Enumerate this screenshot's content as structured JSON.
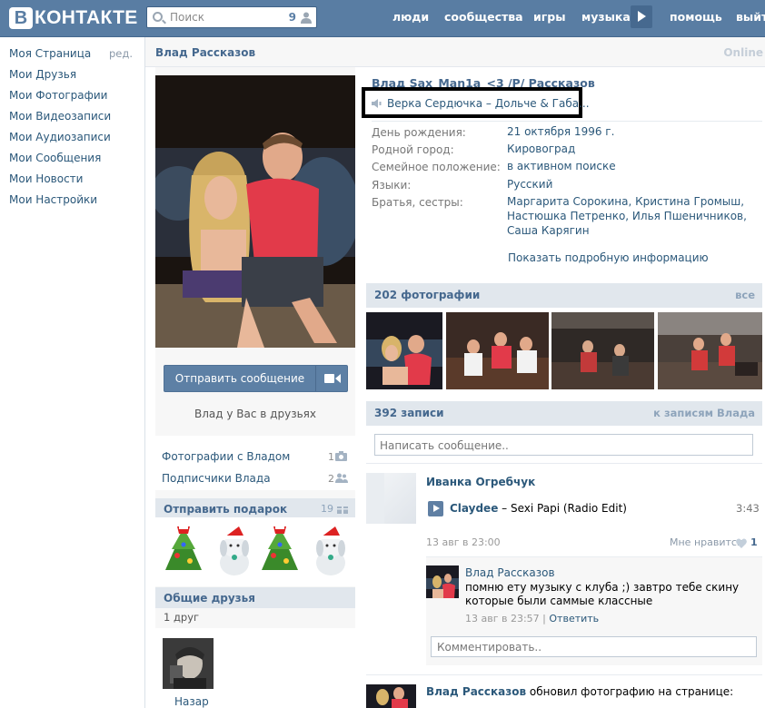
{
  "header": {
    "logo_letter": "В",
    "logo_text": "КОНТАКТЕ",
    "search_placeholder": "Поиск",
    "search_count": "9",
    "nav": [
      "люди",
      "сообщества",
      "игры",
      "музыка",
      "помощь",
      "выйти"
    ]
  },
  "left_menu": {
    "items": [
      "Моя Страница",
      "Мои Друзья",
      "Мои Фотографии",
      "Мои Видеозаписи",
      "Мои Аудиозаписи",
      "Мои Сообщения",
      "Мои Новости",
      "Мои Настройки"
    ],
    "edit_label": "ред."
  },
  "page_header": {
    "name": "Влад Рассказов",
    "status": "Online"
  },
  "profile": {
    "full_name": "Влад Sax_Man1a_<3 /P/ Рассказов",
    "status_text": "Верка Сердючка – Дольче & Габа...",
    "info": [
      {
        "label": "День рождения:",
        "value": "21 октября 1996 г."
      },
      {
        "label": "Родной город:",
        "value": "Кировоград"
      },
      {
        "label": "Семейное положение:",
        "value": "в активном поиске"
      },
      {
        "label": "Языки:",
        "value": "Русский"
      },
      {
        "label": "Братья, сестры:",
        "value": "Маргарита Сорокина, Кристина Громыш, Настюшка Петренко, Илья Пшеничников, Саша Карягин"
      }
    ],
    "show_more": "Показать подробную информацию"
  },
  "left_column": {
    "send_message": "Отправить сообщение",
    "in_friends": "Влад у Вас в друзьях",
    "photos_with": {
      "label": "Фотографии с Владом",
      "count": "1"
    },
    "subscribers": {
      "label": "Подписчики Влада",
      "count": "2"
    },
    "gifts": {
      "title": "Отправить подарок",
      "count": "19"
    },
    "mutual": {
      "title": "Общие друзья",
      "count_label": "1 друг",
      "friend_name": "Назар"
    }
  },
  "photos": {
    "title": "202 фотографии",
    "all_link": "все"
  },
  "wall": {
    "title": "392 записи",
    "link": "к записям Влада",
    "input_placeholder": "Написать сообщение..",
    "post": {
      "author": "Иванка Огребчук",
      "track_artist": "Claydee",
      "track_sep": " – ",
      "track_title": "Sexi Papi (Radio Edit)",
      "track_time": "3:43",
      "date": "13 авг в 23:00",
      "like_label": "Мне нравится",
      "like_count": "1",
      "comment": {
        "author": "Влад Рассказов",
        "text": "помню ету музыку с клуба ;) завтро тебе скину которые были саммые классные",
        "date": "13 авг в 23:57",
        "sep": " | ",
        "reply": "Ответить"
      },
      "comment_placeholder": "Комментировать.."
    },
    "post2": {
      "author": "Влад Рассказов",
      "action": " обновил фотографию на странице:"
    }
  },
  "colors": {
    "header_bg": "#597da3",
    "link": "#2b587a",
    "section_bg": "#e1e7ed",
    "button_bg": "#5d80a5"
  }
}
